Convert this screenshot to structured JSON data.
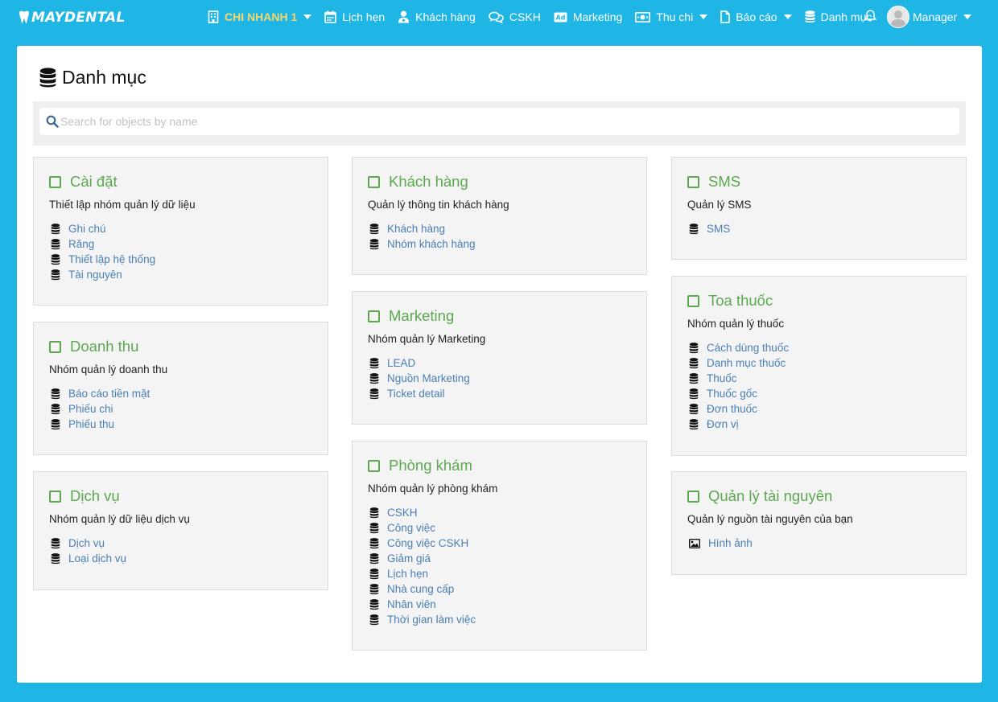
{
  "brand": {
    "name": "MAYDENTAL"
  },
  "nav": {
    "branch": "CHI NHANH 1",
    "appointments": "Lịch hẹn",
    "customers": "Khách hàng",
    "care": "CSKH",
    "marketing": "Marketing",
    "finance": "Thu chi",
    "reports": "Báo cáo",
    "catalog": "Danh mục",
    "user": "Manager"
  },
  "page": {
    "title": "Danh mục",
    "search_placeholder": "Search for objects by name"
  },
  "colors": {
    "background": "#1fb6e6",
    "accent_green": "#5ba84f",
    "link_blue": "#4a7fb5",
    "branch_yellow": "#f5d76e"
  },
  "cards": {
    "settings": {
      "title": "Cài đặt",
      "desc": "Thiết lập nhóm quản lý dữ liệu",
      "items": [
        "Ghi chú",
        "Răng",
        "Thiết lập hệ thống",
        "Tài nguyên"
      ]
    },
    "revenue": {
      "title": "Doanh thu",
      "desc": "Nhóm quản lý doanh thu",
      "items": [
        "Báo cáo tiền mặt",
        "Phiếu chi",
        "Phiếu thu"
      ]
    },
    "services": {
      "title": "Dịch vụ",
      "desc": "Nhóm quản lý dữ liệu dịch vụ",
      "items": [
        "Dịch vụ",
        "Loại dịch vụ"
      ]
    },
    "customers": {
      "title": "Khách hàng",
      "desc": "Quản lý thông tin khách hàng",
      "items": [
        "Khách hàng",
        "Nhóm khách hàng"
      ]
    },
    "marketing": {
      "title": "Marketing",
      "desc": "Nhóm quản lý Marketing",
      "items": [
        "LEAD",
        "Nguồn Marketing",
        "Ticket detail"
      ]
    },
    "clinic": {
      "title": "Phòng khám",
      "desc": "Nhóm quản lý phòng khám",
      "items": [
        "CSKH",
        "Công việc",
        "Công việc CSKH",
        "Giảm giá",
        "Lịch hẹn",
        "Nhà cung cấp",
        "Nhân viên",
        "Thời gian làm việc"
      ]
    },
    "sms": {
      "title": "SMS",
      "desc": "Quản lý SMS",
      "items": [
        "SMS"
      ]
    },
    "prescription": {
      "title": "Toa thuốc",
      "desc": "Nhóm quản lý thuốc",
      "items": [
        "Cách dùng thuốc",
        "Danh mục thuốc",
        "Thuốc",
        "Thuốc gốc",
        "Đơn thuốc",
        "Đơn vị"
      ]
    },
    "resources": {
      "title": "Quản lý tài nguyên",
      "desc": "Quản lý nguồn tài nguyên của bạn",
      "items": [
        "Hình ảnh"
      ]
    }
  }
}
